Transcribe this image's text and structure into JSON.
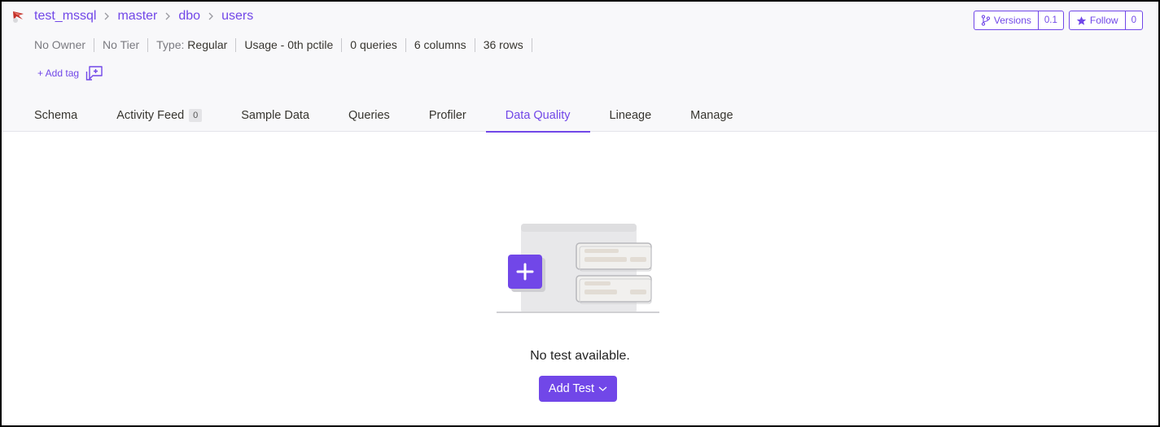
{
  "breadcrumb": {
    "service_icon": "mssql-service-icon",
    "items": [
      "test_mssql",
      "master",
      "dbo",
      "users"
    ]
  },
  "meta": {
    "owner": "No Owner",
    "tier": "No Tier",
    "type_label": "Type:",
    "type_value": "Regular",
    "usage": "Usage - 0th pctile",
    "queries": "0 queries",
    "columns": "6 columns",
    "rows": "36 rows"
  },
  "add_tag": {
    "label": "+ Add tag",
    "icon": "tag-request-icon"
  },
  "tabs": [
    {
      "label": "Schema"
    },
    {
      "label": "Activity Feed",
      "badge": "0"
    },
    {
      "label": "Sample Data"
    },
    {
      "label": "Queries"
    },
    {
      "label": "Profiler"
    },
    {
      "label": "Data Quality",
      "active": true
    },
    {
      "label": "Lineage"
    },
    {
      "label": "Manage"
    }
  ],
  "actions": {
    "versions": {
      "label": "Versions",
      "count": "0.1",
      "icon": "version-branch-icon"
    },
    "follow": {
      "label": "Follow",
      "count": "0",
      "icon": "star-icon"
    }
  },
  "empty_state": {
    "message": "No test available.",
    "button": "Add Test",
    "illustration": "add-test-illustration"
  },
  "colors": {
    "accent": "#7147e8",
    "header_bg": "#f8f8fa"
  }
}
